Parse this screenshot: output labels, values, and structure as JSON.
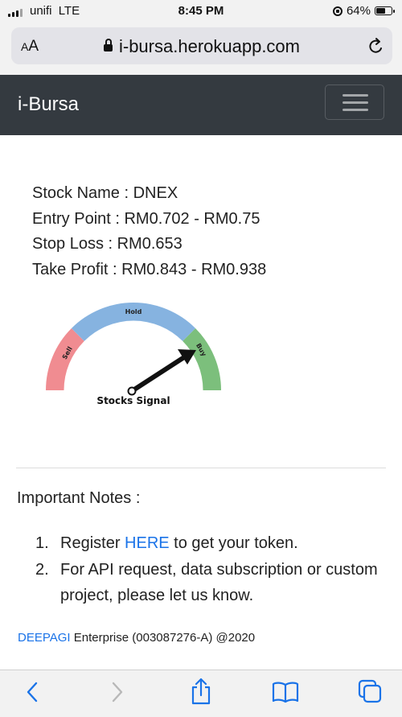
{
  "status": {
    "carrier": "unifi",
    "network": "LTE",
    "time": "8:45 PM",
    "battery": "64%",
    "battery_level": 0.64
  },
  "browser": {
    "text_size_label": "AA",
    "url": "i-bursa.herokuapp.com"
  },
  "navbar": {
    "brand": "i-Bursa",
    "menu_icon": "hamburger-menu-icon"
  },
  "stock": {
    "name_line": "Stock Name : DNEX",
    "entry_line": "Entry Point : RM0.702 - RM0.75",
    "stop_line": "Stop Loss : RM0.653",
    "profit_line": "Take Profit : RM0.843 - RM0.938"
  },
  "gauge": {
    "sell_label": "Sell",
    "hold_label": "Hold",
    "buy_label": "Buy",
    "title": "Stocks Signal",
    "signal": "Buy",
    "colors": {
      "sell": "#f08c91",
      "hold": "#86b3e0",
      "buy": "#7cbf7c"
    }
  },
  "notes": {
    "title": "Important Notes :",
    "item1": {
      "number": "1.",
      "prefix": "Register ",
      "link": "HERE",
      "suffix": " to get your token."
    },
    "item2": {
      "number": "2.",
      "text": "For API request, data subscription or custom project, please let us know."
    }
  },
  "footer": {
    "company_link": "DEEPAGI",
    "text": " Enterprise (003087276-A) @2020"
  },
  "toolbar": {
    "icons": [
      "back-chevron-icon",
      "forward-chevron-icon",
      "share-icon",
      "bookmarks-book-icon",
      "tabs-icon"
    ]
  },
  "accent_color": "#1a73e8"
}
